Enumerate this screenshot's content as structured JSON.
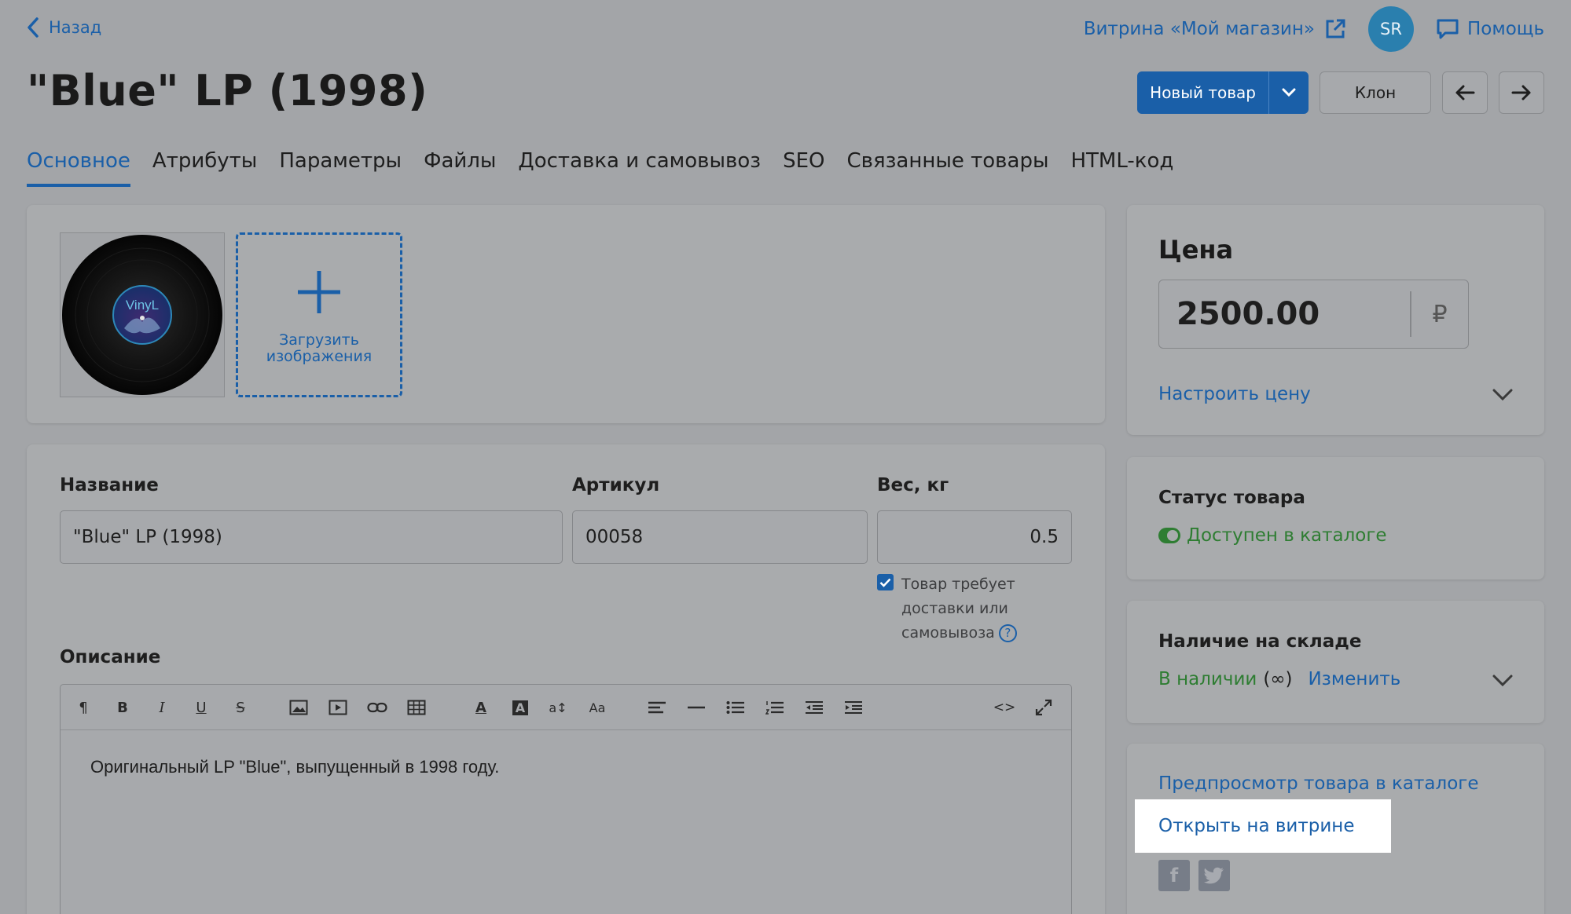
{
  "nav": {
    "back_label": "Назад",
    "storefront_label": "Витрина «Мой магазин»",
    "avatar_initials": "SR",
    "help_label": "Помощь"
  },
  "page": {
    "title": "\"Blue\" LP (1998)"
  },
  "actions": {
    "new_product_label": "Новый товар",
    "clone_label": "Клон"
  },
  "tabs": [
    {
      "label": "Основное",
      "active": true
    },
    {
      "label": "Атрибуты"
    },
    {
      "label": "Параметры"
    },
    {
      "label": "Файлы"
    },
    {
      "label": "Доставка и самовывоз"
    },
    {
      "label": "SEO"
    },
    {
      "label": "Связанные товары"
    },
    {
      "label": "HTML-код"
    }
  ],
  "images": {
    "thumb_text": "VinyL",
    "upload_label_line1": "Загрузить",
    "upload_label_line2": "изображения"
  },
  "form": {
    "name_label": "Название",
    "name_value": "\"Blue\" LP (1998)",
    "sku_label": "Артикул",
    "sku_value": "00058",
    "weight_label": "Вес, кг",
    "weight_value": "0.5",
    "delivery_checkbox_label": "Товар требует доставки или самовывоза",
    "delivery_checked": true,
    "help_glyph": "?",
    "description_label": "Описание",
    "description_text": "Оригинальный LP \"Blue\", выпущенный в 1998 году."
  },
  "editor_toolbar": {
    "paragraph": "¶",
    "bold": "B",
    "italic": "I",
    "underline": "U",
    "strike": "S",
    "text_color": "A",
    "bg_color": "A",
    "font_size": "a↕",
    "font_family": "Aa",
    "code": "<>"
  },
  "price": {
    "title": "Цена",
    "value": "2500.00",
    "currency": "₽",
    "setup_label": "Настроить цену"
  },
  "status": {
    "title": "Статус товара",
    "value": "Доступен в каталоге"
  },
  "stock": {
    "title": "Наличие на складе",
    "value": "В наличии",
    "quantity": "(∞)",
    "change_label": "Изменить"
  },
  "links": {
    "preview_label": "Предпросмотр товара в каталоге",
    "open_store_label": "Открыть на витрине",
    "facebook_glyph": "f"
  },
  "colors": {
    "accent": "#1a5fa8",
    "success": "#2e7d32",
    "background_dimmed": "#a3a5a8"
  }
}
